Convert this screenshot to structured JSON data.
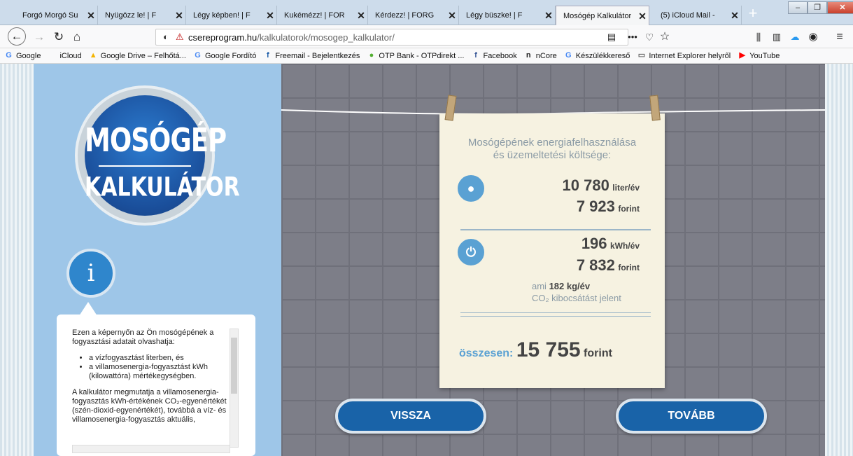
{
  "tabs": [
    {
      "title": "Forgó Morgó Su"
    },
    {
      "title": "Nyügözz le! | F"
    },
    {
      "title": "Légy képben! | F"
    },
    {
      "title": "Kukémézz! | FOR"
    },
    {
      "title": "Kérdezz! | FORG"
    },
    {
      "title": "Légy büszke! | F"
    },
    {
      "title": "Mosógép Kalkulátor"
    },
    {
      "title": "(5) iCloud Mail -"
    }
  ],
  "url": {
    "domain": "csereprogram.hu",
    "path": "/kalkulatorok/mosogep_kalkulator/"
  },
  "bookmarks": [
    {
      "label": "Google",
      "icon": "G",
      "color": "#4285f4"
    },
    {
      "label": "iCloud",
      "icon": "",
      "color": "#333"
    },
    {
      "label": "Google Drive – Felhőtá...",
      "icon": "▲",
      "color": "#f4b400"
    },
    {
      "label": "Google Fordító",
      "icon": "G",
      "color": "#4a8af4"
    },
    {
      "label": "Freemail - Bejelentkezés",
      "icon": "f",
      "color": "#1f5ea8"
    },
    {
      "label": "OTP Bank - OTPdirekt ...",
      "icon": "●",
      "color": "#52ae32"
    },
    {
      "label": "Facebook",
      "icon": "f",
      "color": "#3b5998"
    },
    {
      "label": "nCore",
      "icon": "n",
      "color": "#222"
    },
    {
      "label": "Készülékkereső",
      "icon": "G",
      "color": "#4285f4"
    },
    {
      "label": "Internet Explorer helyről",
      "icon": "▭",
      "color": "#666"
    },
    {
      "label": "YouTube",
      "icon": "▶",
      "color": "#ff0000"
    }
  ],
  "logo": {
    "line1": "MOSÓGÉP",
    "line2": "KALKULÁTOR"
  },
  "info": {
    "icon": "i",
    "para1": "Ezen a képernyőn az Ön mosógépének a fogyasztási adatait olvashatja:",
    "bullet1": "a vízfogyasztást literben, és",
    "bullet2": "a villamosenergia-fogyasztást kWh (kilowattóra) mértékegységben.",
    "para2": "A kalkulátor megmutatja a villamosenergia-fogyasztás kWh-értékének CO₂-egyenértékét (szén-dioxid-egyenértékét), továbbá a víz- és villamosenergia-fogyasztás aktuális,"
  },
  "card": {
    "title1": "Mosógépének energiafelhasználása",
    "title2": "és üzemeltetési költsége:",
    "water": {
      "amount": "10 780",
      "amount_unit": "liter/év",
      "cost": "7 923",
      "cost_unit": "forint"
    },
    "electric": {
      "amount": "196",
      "amount_unit": "kWh/év",
      "cost": "7 832",
      "cost_unit": "forint"
    },
    "co2": {
      "prefix": "ami",
      "value": "182 kg/év",
      "line2": "CO₂ kibocsátást jelent"
    },
    "total": {
      "label": "összesen:",
      "value": "15 755",
      "unit": "forint"
    }
  },
  "buttons": {
    "back": "VISSZA",
    "next": "TOVÁBB"
  }
}
